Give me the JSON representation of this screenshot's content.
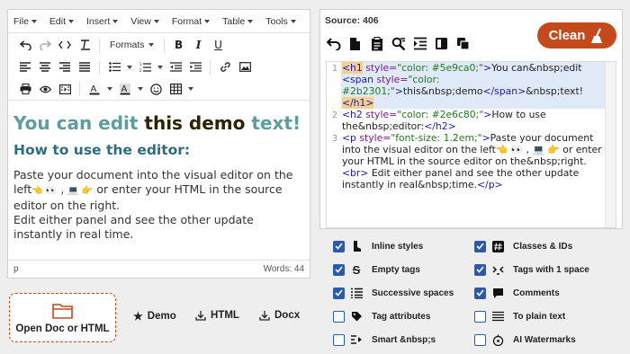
{
  "menu": [
    "File",
    "Edit",
    "Insert",
    "View",
    "Format",
    "Table",
    "Tools"
  ],
  "toolbar": {
    "formats_label": "Formats"
  },
  "content": {
    "h1_part1": "You can edit ",
    "h1_part2": "this demo",
    "h1_part3": " text!",
    "h2": "How to use the editor:",
    "p_line1a": "Paste your document into the visual editor on the left",
    "p_line1b": " , ",
    "p_line1c": " or enter your HTML in the source editor on the right.",
    "p_line2": "Edit either panel and see the other update instantly in real time."
  },
  "status": {
    "path": "p",
    "words_label": "Words: 44"
  },
  "actions": {
    "open_doc": "Open Doc or HTML",
    "demo": "Demo",
    "html": "HTML",
    "docx": "Docx"
  },
  "source": {
    "title": "Source: 406",
    "clean_label": "Clean"
  },
  "code_lines": [
    {
      "n": "1",
      "html": "<span class='tag-hl'>&lt;h1</span> <span class='attr'>style=</span><span class='str'>\"color: #5e9ca0;\"</span><span class='tag'>&gt;</span>You can&amp;nbsp;edit <span class='tag'>&lt;span</span> <span class='attr'>style=</span><span class='str'>\"color: #2b2301;\"</span><span class='tag'>&gt;</span>this&amp;nbsp;demo<span class='tag'>&lt;/span&gt;</span>&amp;nbsp;text!<span class='tag-hl'>&lt;/h1&gt;</span>",
      "sel": true
    },
    {
      "n": "2",
      "html": "<span class='tag'>&lt;h2</span> <span class='attr'>style=</span><span class='str'>\"color: #2e6c80;\"</span><span class='tag'>&gt;</span>How to use the&amp;nbsp;editor:<span class='tag'>&lt;/h2&gt;</span>",
      "sel": false
    },
    {
      "n": "3",
      "html": "<span class='tag'>&lt;p</span> <span class='attr'>style=</span><span class='str'>\"font-size: 1.2em;\"</span><span class='tag'>&gt;</span>Paste your document into the visual editor on the left👈 👀 , 💻 👉 or enter your HTML in the source editor on the&amp;nbsp;right.<span class='tag'>&lt;br&gt;</span> Edit either panel and see the other update instantly in real&amp;nbsp;time.<span class='tag'>&lt;/p&gt;</span>",
      "sel": false
    }
  ],
  "options": {
    "inline_styles": "Inline styles",
    "classes_ids": "Classes & IDs",
    "empty_tags": "Empty tags",
    "tags_one_space": "Tags with 1 space",
    "successive_spaces": "Successive spaces",
    "comments": "Comments",
    "tag_attributes": "Tag attributes",
    "to_plain_text": "To plain text",
    "smart_nbsp": "Smart &nbsp;s",
    "ai_watermarks": "AI Watermarks"
  },
  "colors": {
    "accent": "#c44a1c",
    "checkbox": "#2b5aa8",
    "teal": "#5e9ca0",
    "heading2": "#2e6c80"
  }
}
